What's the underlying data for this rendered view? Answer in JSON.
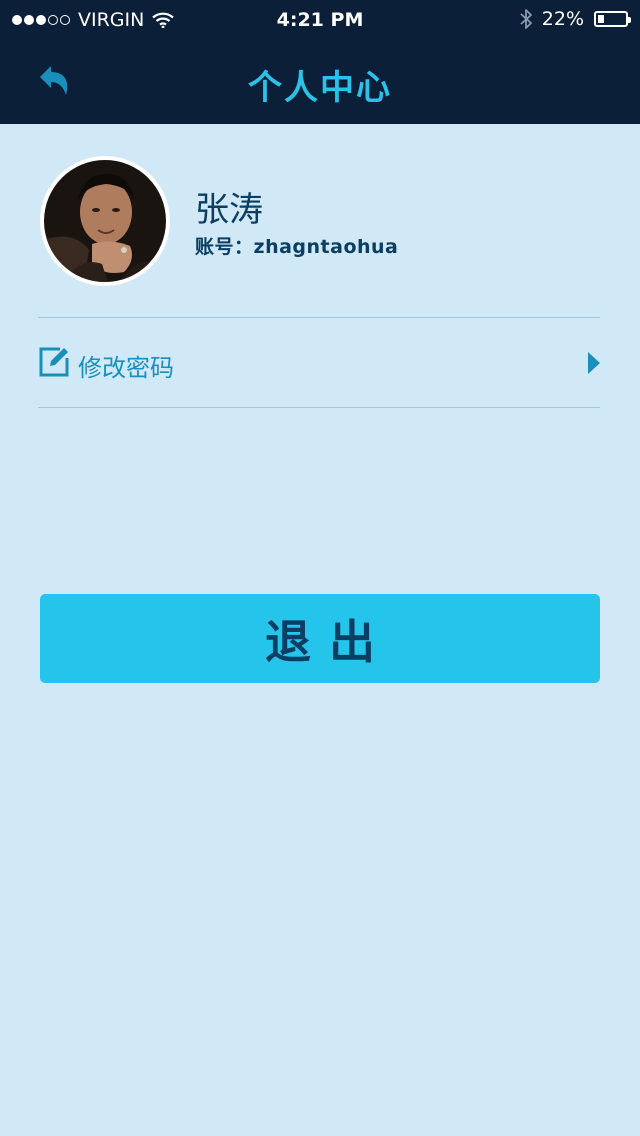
{
  "status_bar": {
    "carrier": "VIRGIN",
    "signal_bars_filled": 3,
    "signal_bars_total": 5,
    "time": "4:21 PM",
    "battery_percent": "22%",
    "battery_level": 0.22,
    "icons": [
      "signal-dots-icon",
      "wifi-icon",
      "bluetooth-icon",
      "battery-icon"
    ]
  },
  "navbar": {
    "title": "个人中心",
    "back_icon": "back-arrow-icon"
  },
  "profile": {
    "name": "张涛",
    "account_label": "账号：",
    "account_value": "zhagntaohua"
  },
  "menu": {
    "items": [
      {
        "label": "修改密码",
        "icon": "edit-icon",
        "trailing_icon": "chevron-right-icon"
      }
    ]
  },
  "logout_button": {
    "label": "退出"
  },
  "colors": {
    "background": "#d1e9f6",
    "topbar": "#0b1f38",
    "accent": "#29c3ea",
    "button": "#25c4ea",
    "dark_text": "#0a3e63",
    "menu_text": "#1b8fbb",
    "divider": "#9cc9da"
  }
}
